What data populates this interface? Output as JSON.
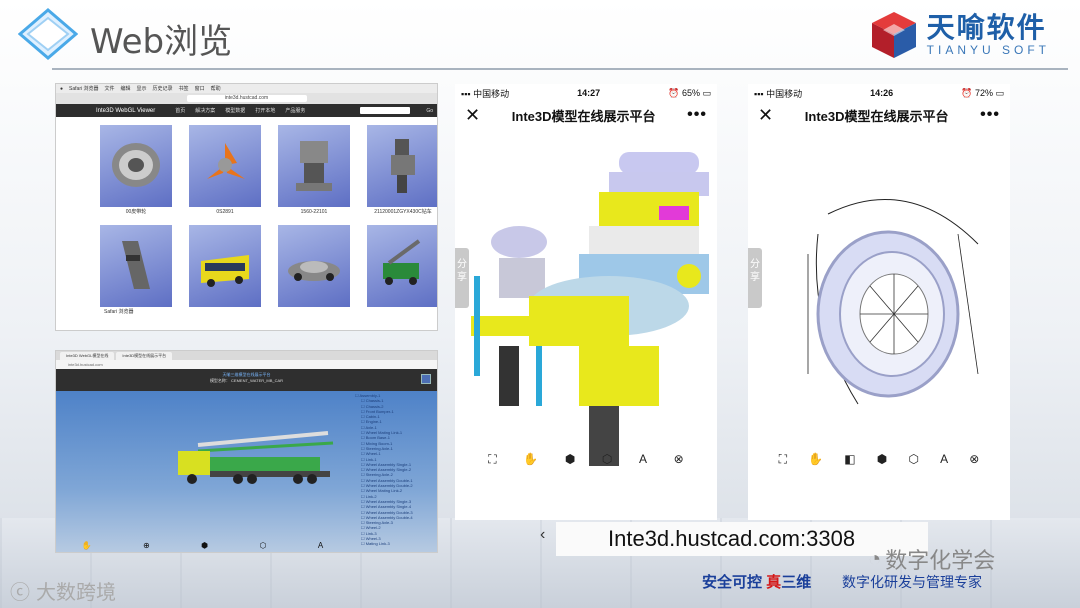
{
  "header": {
    "title": "Web浏览",
    "brand_cn": "天喻软件",
    "brand_en": "TIANYU SOFT"
  },
  "desktop1": {
    "menubar": [
      "Safari 浏览器",
      "文件",
      "编辑",
      "显示",
      "历史记录",
      "书签",
      "窗口",
      "帮助"
    ],
    "url": "inte3d.hustcad.com",
    "site_name": "Inte3D WebGL Viewer",
    "nav_items": [
      "首页",
      "解决方案",
      "模型数据",
      "打开本地",
      "产品服务"
    ],
    "search_btn": "Go",
    "tiles": [
      {
        "caption": "00皮带轮"
      },
      {
        "caption": "0S2891"
      },
      {
        "caption": "1560-22101"
      },
      {
        "caption": "21120001ZGYX430C钻车"
      },
      {
        "caption": "Safari 浏览器"
      },
      {
        "caption": ""
      },
      {
        "caption": ""
      },
      {
        "caption": ""
      }
    ]
  },
  "desktop2": {
    "tabs": [
      "Inte3D WebGL模型在线",
      "Inte3D模型在线展示平台"
    ],
    "url": "inte3d.hustcad.com",
    "viewer_title": "天喻三维模型在线展示平台",
    "model_name": "模型名称：  CEMENT_WATER_MB_CAR",
    "tree_items": [
      "Assembly-1",
      "Chassis-1",
      "Chassis-2",
      "Front Bumper-1",
      "Cabin-1",
      "Engine-1",
      "Axle-1",
      "Wheel Mating Link-1",
      "Boom Base-1",
      "Mixing Boom-1",
      "Steering Axle-1",
      "Wheel-1",
      "Link-1",
      "Wheel Assembly Single-1",
      "Wheel Assembly Single-2",
      "Steering Axle-2",
      "Wheel Assembly Double-1",
      "Wheel Assembly Double-2",
      "Wheel Mating Link-2",
      "Link-2",
      "Wheel Assembly Single-3",
      "Wheel Assembly Single-4",
      "Wheel Assembly Double-3",
      "Wheel Assembly Double-4",
      "Steering Axle-3",
      "Wheel-2",
      "Link-3",
      "Wheel-3",
      "Mating Link-3",
      "Link-4",
      "Wheel Assembly Single-5",
      "Wheel Assembly Single-6",
      "Front Outrigger-1"
    ],
    "tools": [
      "✋",
      "⊕",
      "⬢",
      "⬡",
      "A"
    ]
  },
  "phone1": {
    "carrier": "中国移动",
    "time": "14:27",
    "battery": "65%",
    "title": "Inte3D模型在线展示平台",
    "share": "分享",
    "tools": [
      "⛶",
      "✋",
      "⬢",
      "⬡",
      "A",
      "⊗"
    ]
  },
  "phone2": {
    "carrier": "中国移动",
    "time": "14:26",
    "battery": "72%",
    "title": "Inte3D模型在线展示平台",
    "share": "分享",
    "tools": [
      "⛶",
      "✋",
      "◧",
      "⬢",
      "⬡",
      "A",
      "⊗"
    ]
  },
  "overlay": {
    "url_text": "Inte3d.hustcad.com:3308",
    "watermark_right": "数字化学会",
    "watermark_left": "大数跨境"
  },
  "footer": {
    "slogan_a": "安全可控 ",
    "slogan_red": "真",
    "slogan_b": "三维",
    "slogan_sub": "数字化研发与管理专家"
  }
}
